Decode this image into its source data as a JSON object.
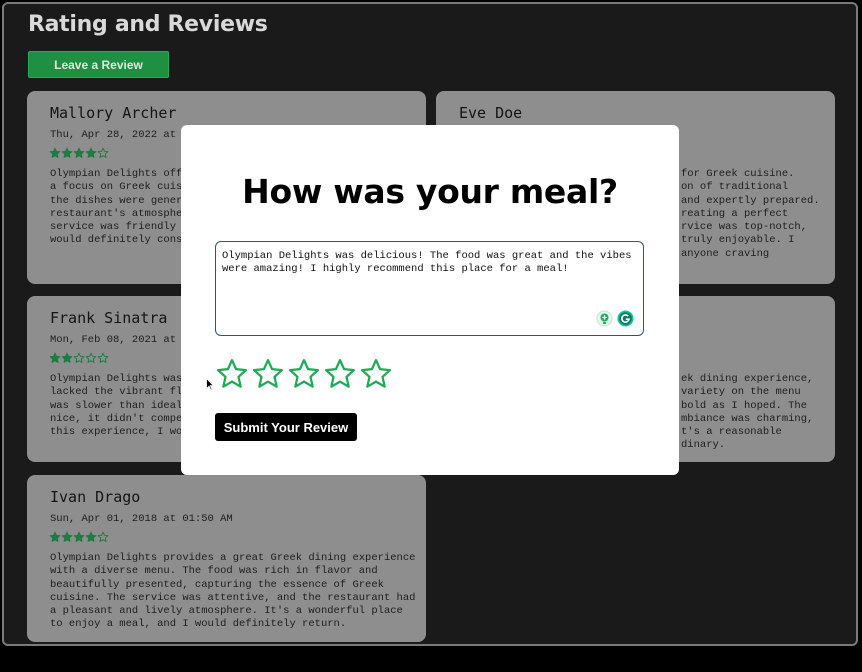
{
  "page": {
    "title": "Rating and Reviews",
    "leave_review_label": "Leave a Review"
  },
  "reviews": [
    {
      "name": "Mallory Archer",
      "date": "Thu, Apr 28, 2022 at 0",
      "rating": 4,
      "text": "Olympian Delights offe\na focus on Greek cuisi\nthe dishes were genera\nrestaurant's atmospher\nservice was friendly a\nwould definitely consi"
    },
    {
      "name": "Eve Doe",
      "date": "",
      "rating": 0,
      "text": "for Greek cuisine.\non of traditional\nand expertly prepared.\nreating a perfect\nrvice was top-notch,\ntruly enjoyable. I\nanyone craving"
    },
    {
      "name": "Frank Sinatra",
      "date": "Mon, Feb 08, 2021 at 0",
      "rating": 2,
      "text": "Olympian Delights was \nlacked the vibrant fla\nwas slower than ideal.\nnice, it didn't compen\nthis experience, I wou"
    },
    {
      "name": "",
      "date": "",
      "rating": 0,
      "text": "ek dining experience,\nvariety on the menu\nbold as I hoped. The\nmbiance was charming,\nt's a reasonable\ndinary."
    },
    {
      "name": "Ivan Drago",
      "date": "Sun, Apr 01, 2018 at 01:50 AM",
      "rating": 4,
      "text": "Olympian Delights provides a great Greek dining experience\nwith a diverse menu. The food was rich in flavor and\nbeautifully presented, capturing the essence of Greek\ncuisine. The service was attentive, and the restaurant had\na pleasant and lively atmosphere. It's a wonderful place\nto enjoy a meal, and I would definitely return."
    }
  ],
  "modal": {
    "title": "How was your meal?",
    "review_text": "Olympian Delights was delicious! The food was great and the vibes were amazing! I highly recommend this place for a meal!",
    "rating_max": 5,
    "rating_selected": 0,
    "submit_label": "Submit Your Review"
  },
  "colors": {
    "star_green": "#1faa55",
    "dim_star": "#1f7a43",
    "card_bg": "#8e8e8e",
    "page_bg": "#1a1a1a",
    "button_green": "#1f8f42"
  },
  "icons": {
    "star": "star-icon",
    "grammar_add": "grammar-add-icon",
    "grammarly": "grammarly-icon"
  }
}
